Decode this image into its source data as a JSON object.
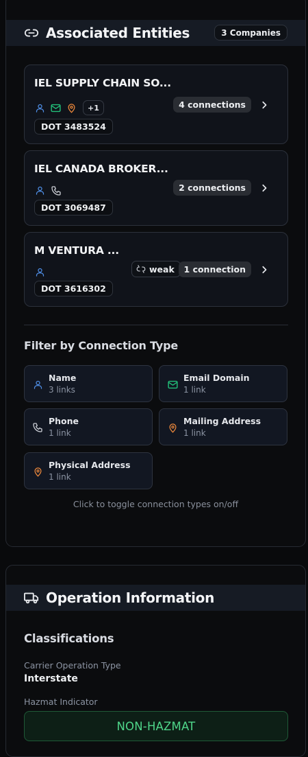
{
  "associated": {
    "title": "Associated Entities",
    "count_badge": "3 Companies",
    "entities": [
      {
        "name": "IEL SUPPLY CHAIN SO...",
        "plus": "+1",
        "dot": "DOT 3483524",
        "connections": "4 connections"
      },
      {
        "name": "IEL CANADA BROKER...",
        "dot": "DOT 3069487",
        "connections": "2 connections"
      },
      {
        "name": "M VENTURA ...",
        "dot": "DOT 3616302",
        "strength": "weak",
        "connections": "1 connection"
      }
    ],
    "filter": {
      "title": "Filter by Connection Type",
      "types": [
        {
          "label": "Name",
          "sub": "3 links",
          "icon": "user-icon"
        },
        {
          "label": "Email Domain",
          "sub": "1 link",
          "icon": "mail-icon"
        },
        {
          "label": "Phone",
          "sub": "1 link",
          "icon": "phone-icon"
        },
        {
          "label": "Mailing Address",
          "sub": "1 link",
          "icon": "map-pin-icon"
        },
        {
          "label": "Physical Address",
          "sub": "1 link",
          "icon": "map-pin-icon"
        }
      ],
      "hint": "Click to toggle connection types on/off"
    }
  },
  "operation": {
    "title": "Operation Information",
    "classifications_title": "Classifications",
    "carrier_operation_label": "Carrier Operation Type",
    "carrier_operation_value": "Interstate",
    "hazmat_label": "Hazmat Indicator",
    "hazmat_value": "NON-HAZMAT"
  },
  "colors": {
    "user": "#4f8fe8",
    "email": "#22c07a",
    "location": "#f08a3c",
    "hazmat_green": "#4fd68a"
  }
}
